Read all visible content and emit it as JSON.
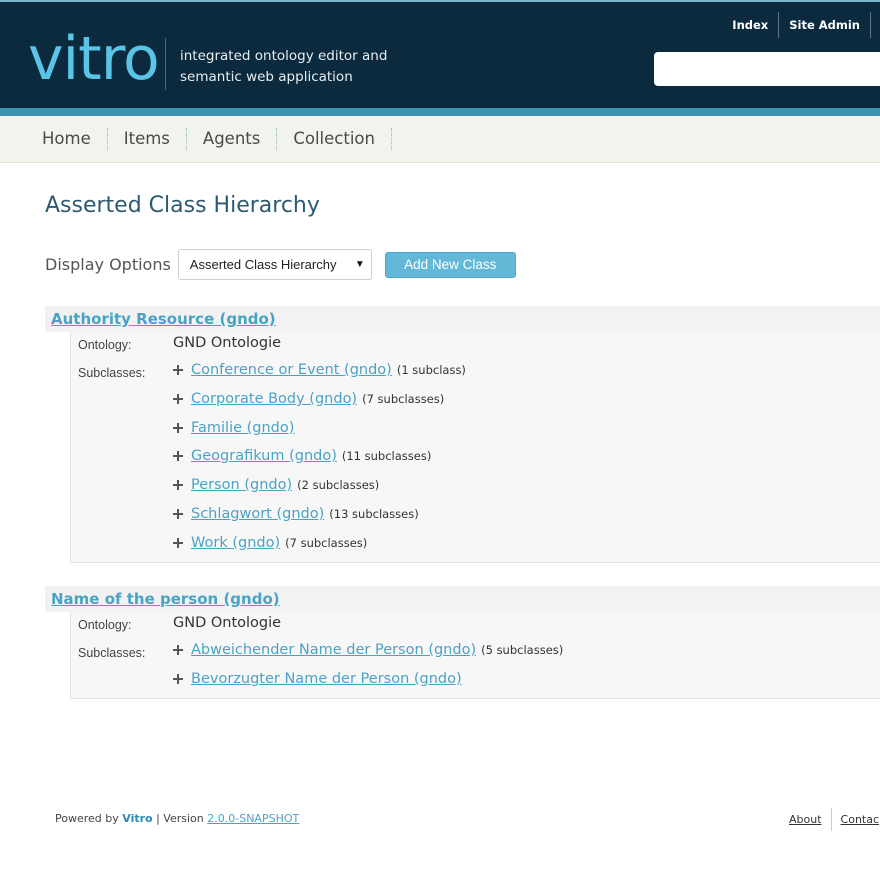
{
  "header": {
    "logo": "vitro",
    "tagline_line1": "integrated ontology editor and",
    "tagline_line2": "semantic web application",
    "links": {
      "index": "Index",
      "site_admin": "Site Admin"
    },
    "search_value": ""
  },
  "nav": {
    "items": [
      "Home",
      "Items",
      "Agents",
      "Collection"
    ]
  },
  "main": {
    "title": "Asserted Class Hierarchy",
    "display_options_label": "Display Options",
    "display_options_selected": "Asserted Class Hierarchy",
    "add_button_label": "Add New Class",
    "ontology_label": "Ontology:",
    "subclasses_label": "Subclasses:",
    "classes": [
      {
        "title": "Authority Resource (gndo)",
        "ontology": "GND Ontologie",
        "subclasses": [
          {
            "name": "Conference or Event (gndo)",
            "count": "(1 subclass)"
          },
          {
            "name": "Corporate Body (gndo)",
            "count": "(7 subclasses)"
          },
          {
            "name": "Familie (gndo)",
            "count": ""
          },
          {
            "name": "Geografikum (gndo)",
            "count": "(11 subclasses)"
          },
          {
            "name": "Person (gndo)",
            "count": "(2 subclasses)"
          },
          {
            "name": "Schlagwort (gndo)",
            "count": "(13 subclasses)"
          },
          {
            "name": "Work (gndo)",
            "count": "(7 subclasses)"
          }
        ]
      },
      {
        "title": "Name of the person (gndo)",
        "ontology": "GND Ontologie",
        "subclasses": [
          {
            "name": "Abweichender Name der Person (gndo)",
            "count": "(5 subclasses)"
          },
          {
            "name": "Bevorzugter Name der Person (gndo)",
            "count": ""
          }
        ]
      }
    ]
  },
  "footer": {
    "powered_by": "Powered by",
    "brand": "Vitro",
    "version_label": "| Version",
    "version": "2.0.0-SNAPSHOT",
    "about": "About",
    "contact": "Contac"
  }
}
